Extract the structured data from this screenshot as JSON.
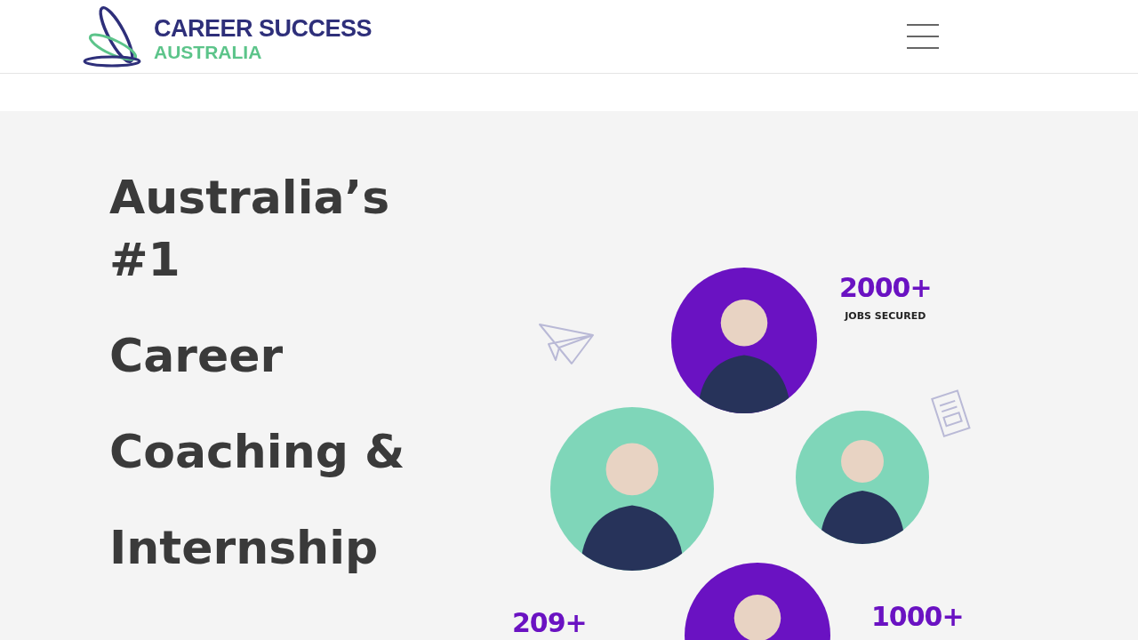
{
  "header": {
    "logo": {
      "title": "CAREER SUCCESS",
      "subtitle": "AUSTRALIA"
    }
  },
  "hero": {
    "headline": [
      "Australia’s #1",
      "Career",
      "Coaching &",
      "Internship"
    ],
    "photos": [
      {
        "color": "#6a12c2"
      },
      {
        "color": "#7fd6b9"
      },
      {
        "color": "#7fd6b9"
      },
      {
        "color": "#6a12c2"
      }
    ],
    "stats": [
      {
        "value": "2000+",
        "label": "JOBS SECURED"
      },
      {
        "value": "209+"
      },
      {
        "value": "1000+"
      }
    ]
  }
}
